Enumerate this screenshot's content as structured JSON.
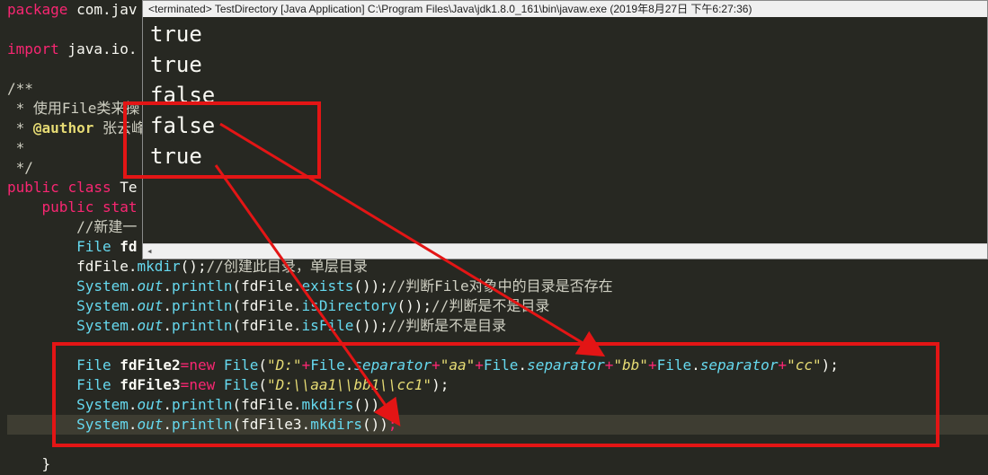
{
  "editor": {
    "lines": [
      {
        "id": "l1",
        "parts": [
          [
            "kw",
            "package"
          ],
          [
            "pl",
            " com.jav"
          ]
        ]
      },
      {
        "id": "l2",
        "parts": []
      },
      {
        "id": "l3",
        "parts": [
          [
            "kw",
            "import"
          ],
          [
            "pl",
            " java.io."
          ]
        ]
      },
      {
        "id": "l4",
        "parts": []
      },
      {
        "id": "l5",
        "parts": [
          [
            "cm",
            "/**"
          ]
        ]
      },
      {
        "id": "l6",
        "parts": [
          [
            "cm",
            " * 使用File类来操"
          ]
        ]
      },
      {
        "id": "l7",
        "parts": [
          [
            "cm",
            " * "
          ],
          [
            "an",
            "@author"
          ],
          [
            "cm",
            " 张云峰"
          ]
        ]
      },
      {
        "id": "l8",
        "parts": [
          [
            "cm",
            " *"
          ]
        ]
      },
      {
        "id": "l9",
        "parts": [
          [
            "cm",
            " */"
          ]
        ]
      },
      {
        "id": "l10",
        "parts": [
          [
            "kw",
            "public"
          ],
          [
            "pl",
            " "
          ],
          [
            "kw",
            "class"
          ],
          [
            "pl",
            " Te"
          ]
        ]
      },
      {
        "id": "l11",
        "parts": [
          [
            "pl",
            "    "
          ],
          [
            "kw",
            "public"
          ],
          [
            "pl",
            " "
          ],
          [
            "kw",
            "stat"
          ]
        ]
      },
      {
        "id": "l12",
        "parts": [
          [
            "pl",
            "        "
          ],
          [
            "cm",
            "//新建一"
          ]
        ]
      },
      {
        "id": "l13",
        "parts": [
          [
            "pl",
            "        "
          ],
          [
            "ty",
            "File"
          ],
          [
            "pl",
            " "
          ],
          [
            "lb",
            "fd"
          ]
        ]
      },
      {
        "id": "l14",
        "parts": [
          [
            "pl",
            "        fdFile."
          ],
          [
            "ty",
            "mkdir"
          ],
          [
            "pl",
            "();"
          ],
          [
            "cm",
            "//创建此目录，单层目录"
          ]
        ]
      },
      {
        "id": "l15",
        "parts": [
          [
            "pl",
            "        "
          ],
          [
            "ty",
            "System"
          ],
          [
            "pl",
            "."
          ],
          [
            "it",
            "out"
          ],
          [
            "pl",
            "."
          ],
          [
            "ty",
            "println"
          ],
          [
            "pl",
            "(fdFile."
          ],
          [
            "ty",
            "exists"
          ],
          [
            "pl",
            "());"
          ],
          [
            "cm",
            "//判断File对象中的目录是否存在"
          ]
        ]
      },
      {
        "id": "l16",
        "parts": [
          [
            "pl",
            "        "
          ],
          [
            "ty",
            "System"
          ],
          [
            "pl",
            "."
          ],
          [
            "it",
            "out"
          ],
          [
            "pl",
            "."
          ],
          [
            "ty",
            "println"
          ],
          [
            "pl",
            "(fdFile."
          ],
          [
            "ty",
            "isDirectory"
          ],
          [
            "pl",
            "());"
          ],
          [
            "cm",
            "//判断是不是目录"
          ]
        ]
      },
      {
        "id": "l17",
        "parts": [
          [
            "pl",
            "        "
          ],
          [
            "ty",
            "System"
          ],
          [
            "pl",
            "."
          ],
          [
            "it",
            "out"
          ],
          [
            "pl",
            "."
          ],
          [
            "ty",
            "println"
          ],
          [
            "pl",
            "(fdFile."
          ],
          [
            "ty",
            "isFile"
          ],
          [
            "pl",
            "());"
          ],
          [
            "cm",
            "//判断是不是目录"
          ]
        ]
      },
      {
        "id": "l18",
        "parts": []
      },
      {
        "id": "l19",
        "parts": [
          [
            "pl",
            "        "
          ],
          [
            "ty",
            "File"
          ],
          [
            "pl",
            " "
          ],
          [
            "lb",
            "fdFile2"
          ],
          [
            "pk",
            "="
          ],
          [
            "kw",
            "new"
          ],
          [
            "pl",
            " "
          ],
          [
            "ty",
            "File"
          ],
          [
            "pl",
            "("
          ],
          [
            "st",
            "\"D:\""
          ],
          [
            "pk",
            "+"
          ],
          [
            "ty",
            "File"
          ],
          [
            "pl",
            "."
          ],
          [
            "it",
            "separator"
          ],
          [
            "pk",
            "+"
          ],
          [
            "st",
            "\"aa\""
          ],
          [
            "pk",
            "+"
          ],
          [
            "ty",
            "File"
          ],
          [
            "pl",
            "."
          ],
          [
            "it",
            "separator"
          ],
          [
            "pk",
            "+"
          ],
          [
            "st",
            "\"bb\""
          ],
          [
            "pk",
            "+"
          ],
          [
            "ty",
            "File"
          ],
          [
            "pl",
            "."
          ],
          [
            "it",
            "separator"
          ],
          [
            "pk",
            "+"
          ],
          [
            "st",
            "\"cc\""
          ],
          [
            "pl",
            ");"
          ]
        ]
      },
      {
        "id": "l20",
        "parts": [
          [
            "pl",
            "        "
          ],
          [
            "ty",
            "File"
          ],
          [
            "pl",
            " "
          ],
          [
            "lb",
            "fdFile3"
          ],
          [
            "pk",
            "="
          ],
          [
            "kw",
            "new"
          ],
          [
            "pl",
            " "
          ],
          [
            "ty",
            "File"
          ],
          [
            "pl",
            "("
          ],
          [
            "st",
            "\"D:\\\\aa1\\\\bb1\\\\cc1\""
          ],
          [
            "pl",
            ");"
          ]
        ]
      },
      {
        "id": "l21",
        "parts": [
          [
            "pl",
            "        "
          ],
          [
            "ty",
            "System"
          ],
          [
            "pl",
            "."
          ],
          [
            "it",
            "out"
          ],
          [
            "pl",
            "."
          ],
          [
            "ty",
            "println"
          ],
          [
            "pl",
            "(fdFile."
          ],
          [
            "ty",
            "mkdirs"
          ],
          [
            "pl",
            "());"
          ]
        ]
      },
      {
        "id": "l22",
        "parts": [
          [
            "pl",
            "        "
          ],
          [
            "ty",
            "System"
          ],
          [
            "pl",
            "."
          ],
          [
            "it",
            "out"
          ],
          [
            "pl",
            "."
          ],
          [
            "ty",
            "println"
          ],
          [
            "pl",
            "(fdFile3."
          ],
          [
            "ty",
            "mkdirs"
          ],
          [
            "pl",
            "())"
          ],
          [
            "pk",
            ";"
          ]
        ]
      },
      {
        "id": "l23",
        "parts": []
      },
      {
        "id": "l24",
        "parts": [
          [
            "pl",
            "    }"
          ]
        ]
      }
    ]
  },
  "console": {
    "header": "<terminated> TestDirectory [Java Application] C:\\Program Files\\Java\\jdk1.8.0_161\\bin\\javaw.exe (2019年8月27日 下午6:27:36)",
    "output": [
      "true",
      "true",
      "false",
      "false",
      "true"
    ]
  },
  "colors": {
    "annotation": "#e31515",
    "editor_bg": "#272822"
  },
  "icons": {
    "scroll_left": "scroll-left-arrow-icon"
  }
}
